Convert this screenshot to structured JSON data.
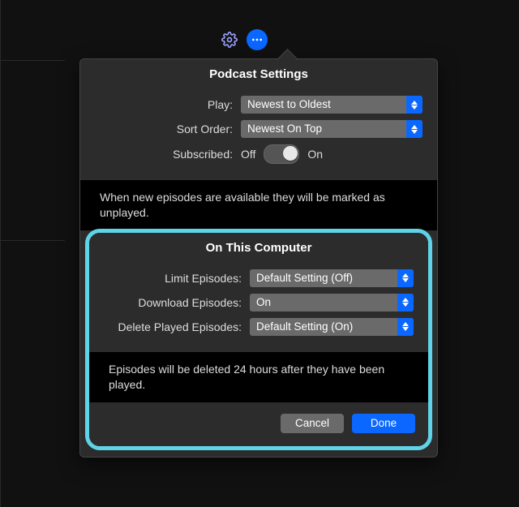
{
  "header": {
    "title": "Podcast Settings"
  },
  "settings": {
    "play": {
      "label": "Play:",
      "value": "Newest to Oldest"
    },
    "sort_order": {
      "label": "Sort Order:",
      "value": "Newest On Top"
    },
    "subscribed": {
      "label": "Subscribed:",
      "off_text": "Off",
      "on_text": "On",
      "state": "On",
      "note": "When new episodes are available they will be marked as unplayed."
    }
  },
  "on_this_computer": {
    "title": "On This Computer",
    "limit_episodes": {
      "label": "Limit Episodes:",
      "value": "Default Setting (Off)"
    },
    "download_episodes": {
      "label": "Download Episodes:",
      "value": "On"
    },
    "delete_played": {
      "label": "Delete Played Episodes:",
      "value": "Default Setting (On)",
      "note": "Episodes will be deleted 24 hours after they have been played."
    }
  },
  "footer": {
    "cancel": "Cancel",
    "done": "Done"
  },
  "colors": {
    "accent": "#0a67ff",
    "highlight_border": "#5fd4e8"
  }
}
